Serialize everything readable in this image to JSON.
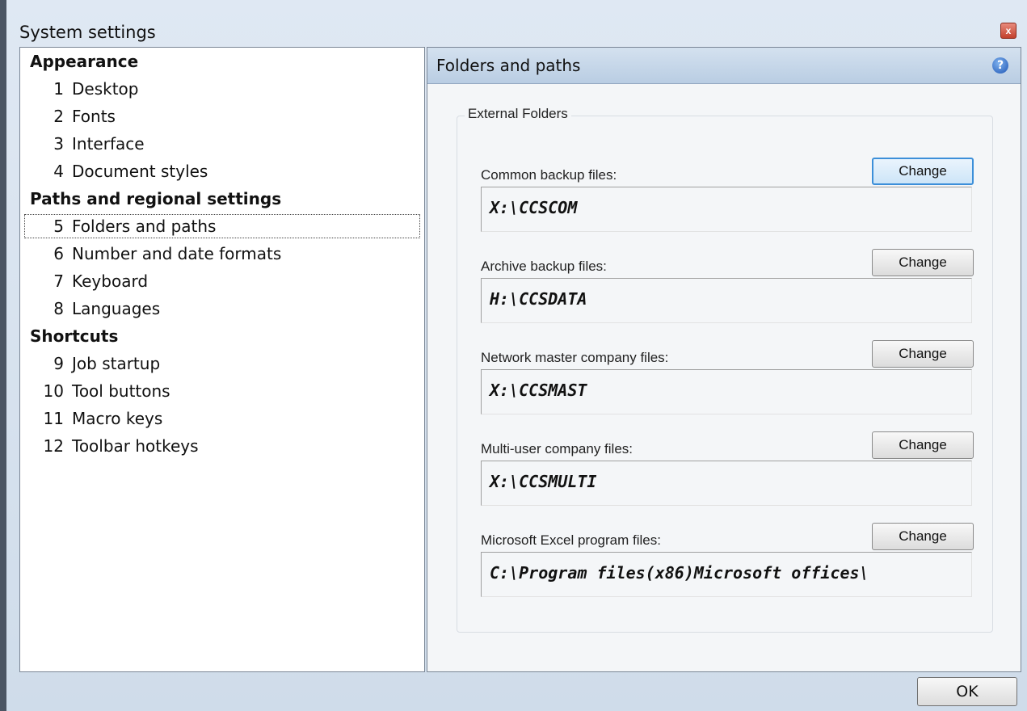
{
  "window": {
    "title": "System settings",
    "close_symbol": "x"
  },
  "nav": {
    "groups": [
      {
        "label": "Appearance",
        "items": [
          {
            "num": "1",
            "label": "Desktop"
          },
          {
            "num": "2",
            "label": "Fonts"
          },
          {
            "num": "3",
            "label": "Interface"
          },
          {
            "num": "4",
            "label": "Document styles"
          }
        ]
      },
      {
        "label": "Paths and regional settings",
        "items": [
          {
            "num": "5",
            "label": "Folders and paths"
          },
          {
            "num": "6",
            "label": "Number and date formats"
          },
          {
            "num": "7",
            "label": "Keyboard"
          },
          {
            "num": "8",
            "label": "Languages"
          }
        ]
      },
      {
        "label": "Shortcuts",
        "items": [
          {
            "num": "9",
            "label": "Job startup"
          },
          {
            "num": "10",
            "label": "Tool buttons"
          },
          {
            "num": "11",
            "label": "Macro keys"
          },
          {
            "num": "12",
            "label": "Toolbar hotkeys"
          }
        ]
      }
    ],
    "selected": "Folders and paths"
  },
  "panel": {
    "title": "Folders and paths",
    "help_symbol": "?",
    "group_label": "External Folders",
    "change_label": "Change",
    "fields": [
      {
        "label": "Common backup files:",
        "path": "X:\\CCSCOM"
      },
      {
        "label": "Archive backup files:",
        "path": "H:\\CCSDATA"
      },
      {
        "label": "Network master company files:",
        "path": "X:\\CCSMAST"
      },
      {
        "label": "Multi-user company files:",
        "path": "X:\\CCSMULTI"
      },
      {
        "label": "Microsoft Excel program files:",
        "path": "C:\\Program files(x86)Microsoft offices\\"
      }
    ]
  },
  "footer": {
    "ok_label": "OK"
  },
  "colors": {
    "window_background": "#d8e2ee",
    "panel_header": "#c6d7ea",
    "focus_border": "#3c8fd9",
    "close_button": "#c2412d"
  }
}
